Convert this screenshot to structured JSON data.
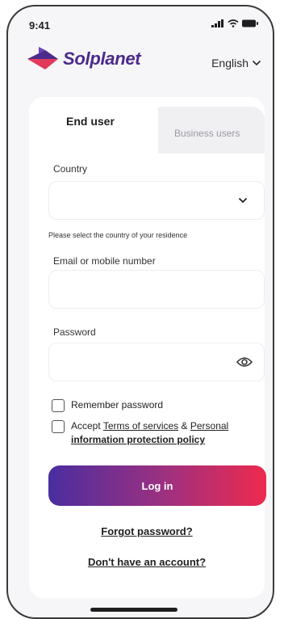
{
  "status_bar": {
    "time": "9:41"
  },
  "brand": {
    "name": "Solplanet"
  },
  "language": {
    "selected": "English"
  },
  "tabs": {
    "end_user": "End user",
    "business": "Business users"
  },
  "form": {
    "country_label": "Country",
    "country_value": "",
    "country_hint": "Please select the country of your residence",
    "email_label": "Email or mobile number",
    "email_value": "",
    "password_label": "Password",
    "password_value": "",
    "remember_label": "Remember password",
    "accept_prefix": "Accept ",
    "terms_link": "Terms of services",
    "accept_and": " & ",
    "privacy_link_1": "Personal",
    "privacy_link_2": "information protection policy",
    "login_button": "Log in"
  },
  "links": {
    "forgot": "Forgot password?",
    "signup": "Don't have an account?"
  },
  "colors": {
    "brand_purple": "#4b2a8c",
    "gradient_start": "#4a2ea0",
    "gradient_end": "#ee2a4e"
  },
  "icons": {
    "chevron": "chevron-down-icon",
    "eye": "eye-icon",
    "logo": "solplanet-logo-icon"
  }
}
